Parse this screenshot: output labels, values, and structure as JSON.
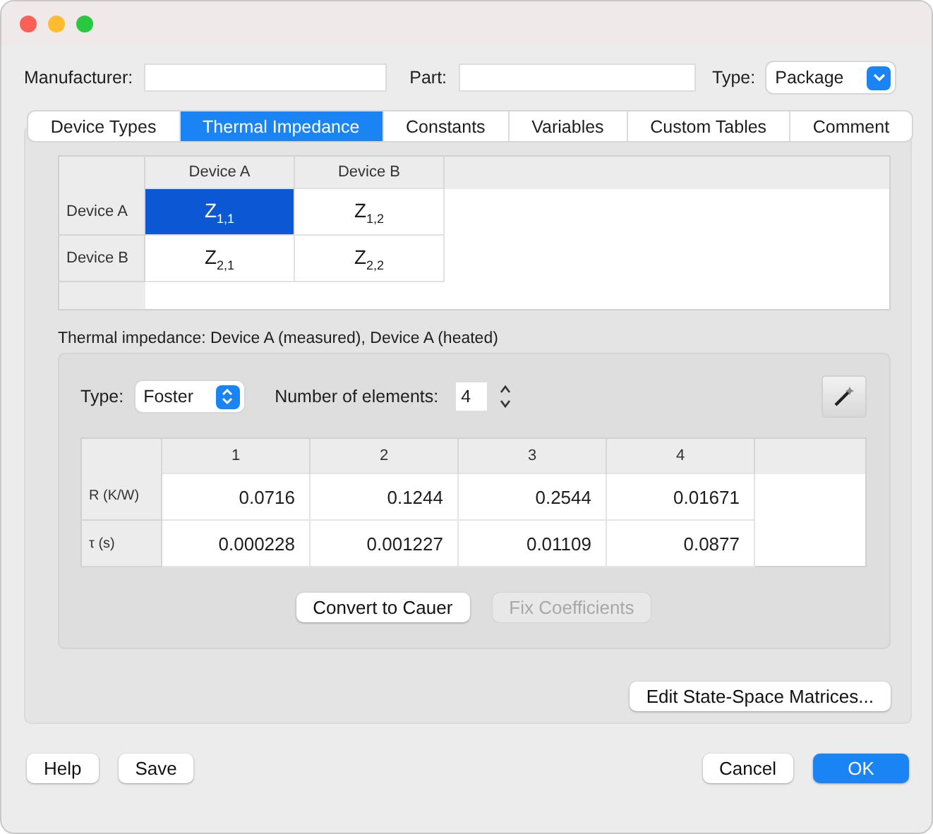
{
  "header": {
    "manufacturer": {
      "label": "Manufacturer:"
    },
    "part": {
      "label": "Part:"
    },
    "type": {
      "label": "Type:",
      "value": "Package"
    }
  },
  "tabs": [
    {
      "label": "Device Types",
      "selected": false
    },
    {
      "label": "Thermal Impedance",
      "selected": true
    },
    {
      "label": "Constants",
      "selected": false
    },
    {
      "label": "Variables",
      "selected": false
    },
    {
      "label": "Custom Tables",
      "selected": false
    },
    {
      "label": "Comment",
      "selected": false
    }
  ],
  "matrix": {
    "columns": [
      "Device A",
      "Device B"
    ],
    "rows": [
      {
        "label": "Device A",
        "cells": [
          {
            "text": "Z$_{1,1}$",
            "selected": true
          },
          {
            "text": "Z$_{1,2}$",
            "selected": false
          }
        ]
      },
      {
        "label": "Device B",
        "cells": [
          {
            "text": "Z$_{2,1}$",
            "selected": false
          },
          {
            "text": "Z$_{2,2}$",
            "selected": false
          }
        ]
      }
    ]
  },
  "caption": "Thermal impedance: Device A (measured), Device A (heated)",
  "model": {
    "type_label": "Type:",
    "type_value": "Foster",
    "count_label": "Number of elements:",
    "count_value": "4",
    "columns": [
      "1",
      "2",
      "3",
      "4"
    ],
    "rows": [
      {
        "label": "R (K/W)",
        "values": [
          "0.0716",
          "0.1244",
          "0.2544",
          "0.01671"
        ]
      },
      {
        "label": "τ (s)",
        "values": [
          "0.000228",
          "0.001227",
          "0.01109",
          "0.0877"
        ]
      }
    ],
    "buttons": [
      {
        "label": "Convert to Cauer",
        "disabled": false
      },
      {
        "label": "Fix Coefficients",
        "disabled": true
      }
    ]
  },
  "edit_button": {
    "label": "Edit State-Space Matrices...",
    "disabled": false
  },
  "footer": {
    "left": [
      {
        "label": "Help",
        "default": false
      },
      {
        "label": "Save",
        "default": false
      }
    ],
    "right": [
      {
        "label": "Cancel",
        "default": false
      },
      {
        "label": "OK",
        "default": true
      }
    ]
  }
}
